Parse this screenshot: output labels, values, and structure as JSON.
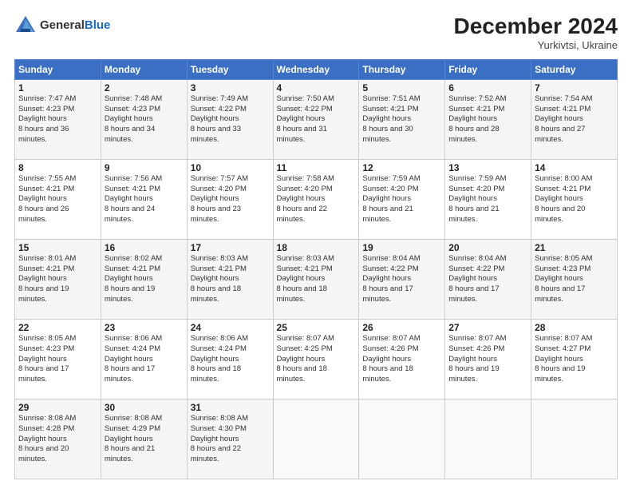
{
  "header": {
    "logo_line1": "General",
    "logo_line2": "Blue",
    "month_title": "December 2024",
    "subtitle": "Yurkivtsi, Ukraine"
  },
  "days_of_week": [
    "Sunday",
    "Monday",
    "Tuesday",
    "Wednesday",
    "Thursday",
    "Friday",
    "Saturday"
  ],
  "weeks": [
    [
      {
        "day": "1",
        "sunrise": "7:47 AM",
        "sunset": "4:23 PM",
        "daylight": "8 hours and 36 minutes."
      },
      {
        "day": "2",
        "sunrise": "7:48 AM",
        "sunset": "4:23 PM",
        "daylight": "8 hours and 34 minutes."
      },
      {
        "day": "3",
        "sunrise": "7:49 AM",
        "sunset": "4:22 PM",
        "daylight": "8 hours and 33 minutes."
      },
      {
        "day": "4",
        "sunrise": "7:50 AM",
        "sunset": "4:22 PM",
        "daylight": "8 hours and 31 minutes."
      },
      {
        "day": "5",
        "sunrise": "7:51 AM",
        "sunset": "4:21 PM",
        "daylight": "8 hours and 30 minutes."
      },
      {
        "day": "6",
        "sunrise": "7:52 AM",
        "sunset": "4:21 PM",
        "daylight": "8 hours and 28 minutes."
      },
      {
        "day": "7",
        "sunrise": "7:54 AM",
        "sunset": "4:21 PM",
        "daylight": "8 hours and 27 minutes."
      }
    ],
    [
      {
        "day": "8",
        "sunrise": "7:55 AM",
        "sunset": "4:21 PM",
        "daylight": "8 hours and 26 minutes."
      },
      {
        "day": "9",
        "sunrise": "7:56 AM",
        "sunset": "4:21 PM",
        "daylight": "8 hours and 24 minutes."
      },
      {
        "day": "10",
        "sunrise": "7:57 AM",
        "sunset": "4:20 PM",
        "daylight": "8 hours and 23 minutes."
      },
      {
        "day": "11",
        "sunrise": "7:58 AM",
        "sunset": "4:20 PM",
        "daylight": "8 hours and 22 minutes."
      },
      {
        "day": "12",
        "sunrise": "7:59 AM",
        "sunset": "4:20 PM",
        "daylight": "8 hours and 21 minutes."
      },
      {
        "day": "13",
        "sunrise": "7:59 AM",
        "sunset": "4:20 PM",
        "daylight": "8 hours and 21 minutes."
      },
      {
        "day": "14",
        "sunrise": "8:00 AM",
        "sunset": "4:21 PM",
        "daylight": "8 hours and 20 minutes."
      }
    ],
    [
      {
        "day": "15",
        "sunrise": "8:01 AM",
        "sunset": "4:21 PM",
        "daylight": "8 hours and 19 minutes."
      },
      {
        "day": "16",
        "sunrise": "8:02 AM",
        "sunset": "4:21 PM",
        "daylight": "8 hours and 19 minutes."
      },
      {
        "day": "17",
        "sunrise": "8:03 AM",
        "sunset": "4:21 PM",
        "daylight": "8 hours and 18 minutes."
      },
      {
        "day": "18",
        "sunrise": "8:03 AM",
        "sunset": "4:21 PM",
        "daylight": "8 hours and 18 minutes."
      },
      {
        "day": "19",
        "sunrise": "8:04 AM",
        "sunset": "4:22 PM",
        "daylight": "8 hours and 17 minutes."
      },
      {
        "day": "20",
        "sunrise": "8:04 AM",
        "sunset": "4:22 PM",
        "daylight": "8 hours and 17 minutes."
      },
      {
        "day": "21",
        "sunrise": "8:05 AM",
        "sunset": "4:23 PM",
        "daylight": "8 hours and 17 minutes."
      }
    ],
    [
      {
        "day": "22",
        "sunrise": "8:05 AM",
        "sunset": "4:23 PM",
        "daylight": "8 hours and 17 minutes."
      },
      {
        "day": "23",
        "sunrise": "8:06 AM",
        "sunset": "4:24 PM",
        "daylight": "8 hours and 17 minutes."
      },
      {
        "day": "24",
        "sunrise": "8:06 AM",
        "sunset": "4:24 PM",
        "daylight": "8 hours and 18 minutes."
      },
      {
        "day": "25",
        "sunrise": "8:07 AM",
        "sunset": "4:25 PM",
        "daylight": "8 hours and 18 minutes."
      },
      {
        "day": "26",
        "sunrise": "8:07 AM",
        "sunset": "4:26 PM",
        "daylight": "8 hours and 18 minutes."
      },
      {
        "day": "27",
        "sunrise": "8:07 AM",
        "sunset": "4:26 PM",
        "daylight": "8 hours and 19 minutes."
      },
      {
        "day": "28",
        "sunrise": "8:07 AM",
        "sunset": "4:27 PM",
        "daylight": "8 hours and 19 minutes."
      }
    ],
    [
      {
        "day": "29",
        "sunrise": "8:08 AM",
        "sunset": "4:28 PM",
        "daylight": "8 hours and 20 minutes."
      },
      {
        "day": "30",
        "sunrise": "8:08 AM",
        "sunset": "4:29 PM",
        "daylight": "8 hours and 21 minutes."
      },
      {
        "day": "31",
        "sunrise": "8:08 AM",
        "sunset": "4:30 PM",
        "daylight": "8 hours and 22 minutes."
      },
      null,
      null,
      null,
      null
    ]
  ]
}
